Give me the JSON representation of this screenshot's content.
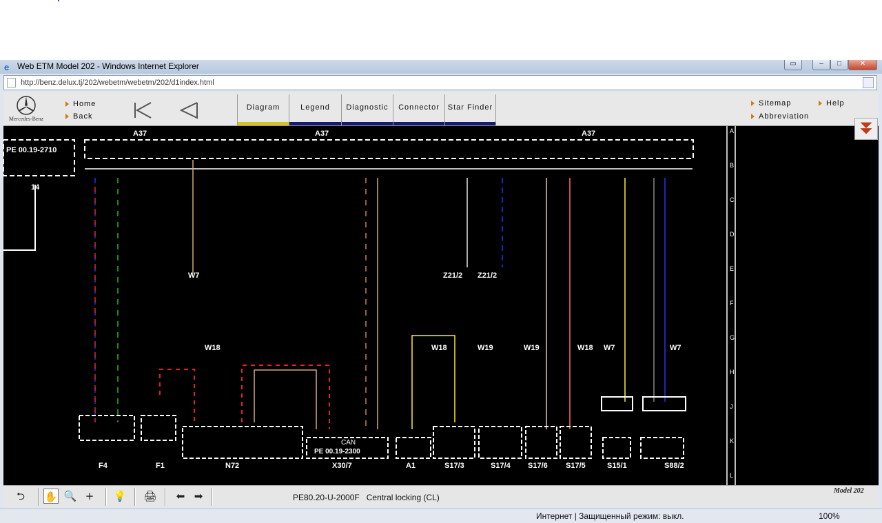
{
  "browser": {
    "title": "Web ETM Model 202 - Windows Internet Explorer",
    "url": "http://benz.delux.tj/202/webetm/webetm/202/d1index.html"
  },
  "header": {
    "brand": "Mercedes-Benz",
    "home": "Home",
    "back": "Back",
    "sitemap": "Sitemap",
    "help": "Help",
    "abbreviation": "Abbreviation"
  },
  "tabs": [
    "Diagram",
    "Legend",
    "Diagnostic",
    "Connector",
    "Star Finder"
  ],
  "diagram": {
    "labels": {
      "a37": "A37",
      "pe_ref": "PE 00.19-2710",
      "ref_num": "14",
      "w7": "W7",
      "w18": "W18",
      "w19": "W19",
      "z21": "Z21/2",
      "f4": "F4",
      "f1": "F1",
      "n72": "N72",
      "x30": "X30/7",
      "a1": "A1",
      "s17_3": "S17/3",
      "s17_4": "S17/4",
      "s17_6": "S17/6",
      "s17_5": "S17/5",
      "s15_1": "S15/1",
      "s88_2": "S88/2",
      "pe_x30": "PE 00.19-2300",
      "can": "CAN"
    },
    "rows": [
      "A",
      "B",
      "C",
      "D",
      "E",
      "F",
      "G",
      "H",
      "J",
      "K",
      "L"
    ]
  },
  "toolbar": {
    "doc_code": "PE80.20-U-2000F",
    "doc_title": "Central locking (CL)",
    "model": "Model 202"
  },
  "status": {
    "zone": "Интернет | Защищенный режим: выкл.",
    "zoom": "100%"
  }
}
